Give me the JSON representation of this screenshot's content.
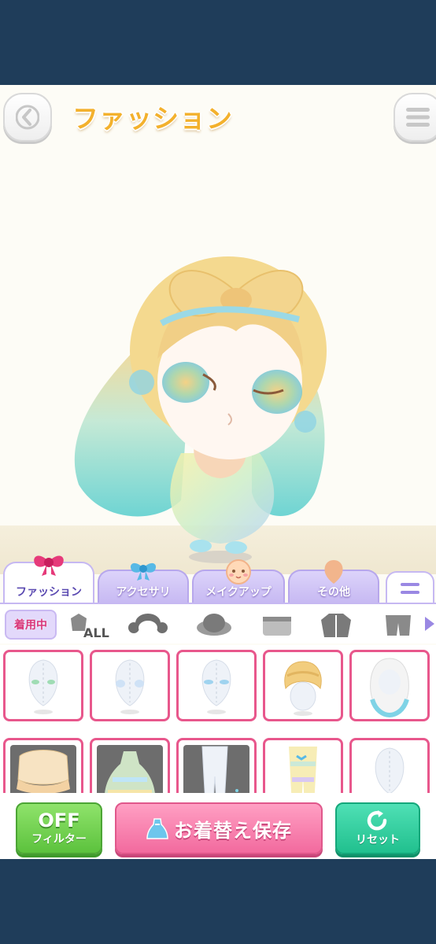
{
  "header": {
    "title": "ファッション",
    "back_icon": "chevron-left-icon",
    "menu_icon": "hamburger-menu-icon"
  },
  "tabs": [
    {
      "label": "ファッション",
      "icon": "ribbon-bow-icon",
      "active": true
    },
    {
      "label": "アクセサリ",
      "icon": "blue-bow-icon",
      "active": false
    },
    {
      "label": "メイクアップ",
      "icon": "face-icon",
      "active": false
    },
    {
      "label": "その他",
      "icon": "silhouette-icon",
      "active": false
    }
  ],
  "tabs_more_icon": "equals-icon",
  "subcategories": {
    "wearing_label": "着用中",
    "all_label": "ALL",
    "icons": [
      "outfit-all-icon",
      "hair-icon",
      "hat-icon",
      "tops-icon",
      "coat-icon",
      "bottoms-icon"
    ],
    "next_icon": "arrow-right-icon"
  },
  "items": [
    {
      "name": "body-face-green-eyes"
    },
    {
      "name": "body-face-blue-cheeks"
    },
    {
      "name": "body-face-blue-eyes"
    },
    {
      "name": "blonde-braid-hair"
    },
    {
      "name": "white-aqua-long-hair"
    },
    {
      "name": "peach-ruffle-top"
    },
    {
      "name": "rainbow-tulle-dress"
    },
    {
      "name": "white-tights"
    },
    {
      "name": "pastel-rainbow-leggings"
    },
    {
      "name": "plain-body"
    }
  ],
  "bottom_bar": {
    "filter_top": "OFF",
    "filter_bottom": "フィルター",
    "save_label": "お着替え保存",
    "reset_label": "リセット"
  },
  "colors": {
    "accent_purple": "#c6b8f2",
    "item_border_pink": "#e8578c",
    "filter_green": "#5cc23d",
    "save_pink": "#f26a9e",
    "reset_teal": "#21c08e",
    "title_gold": "#f3b12d"
  }
}
